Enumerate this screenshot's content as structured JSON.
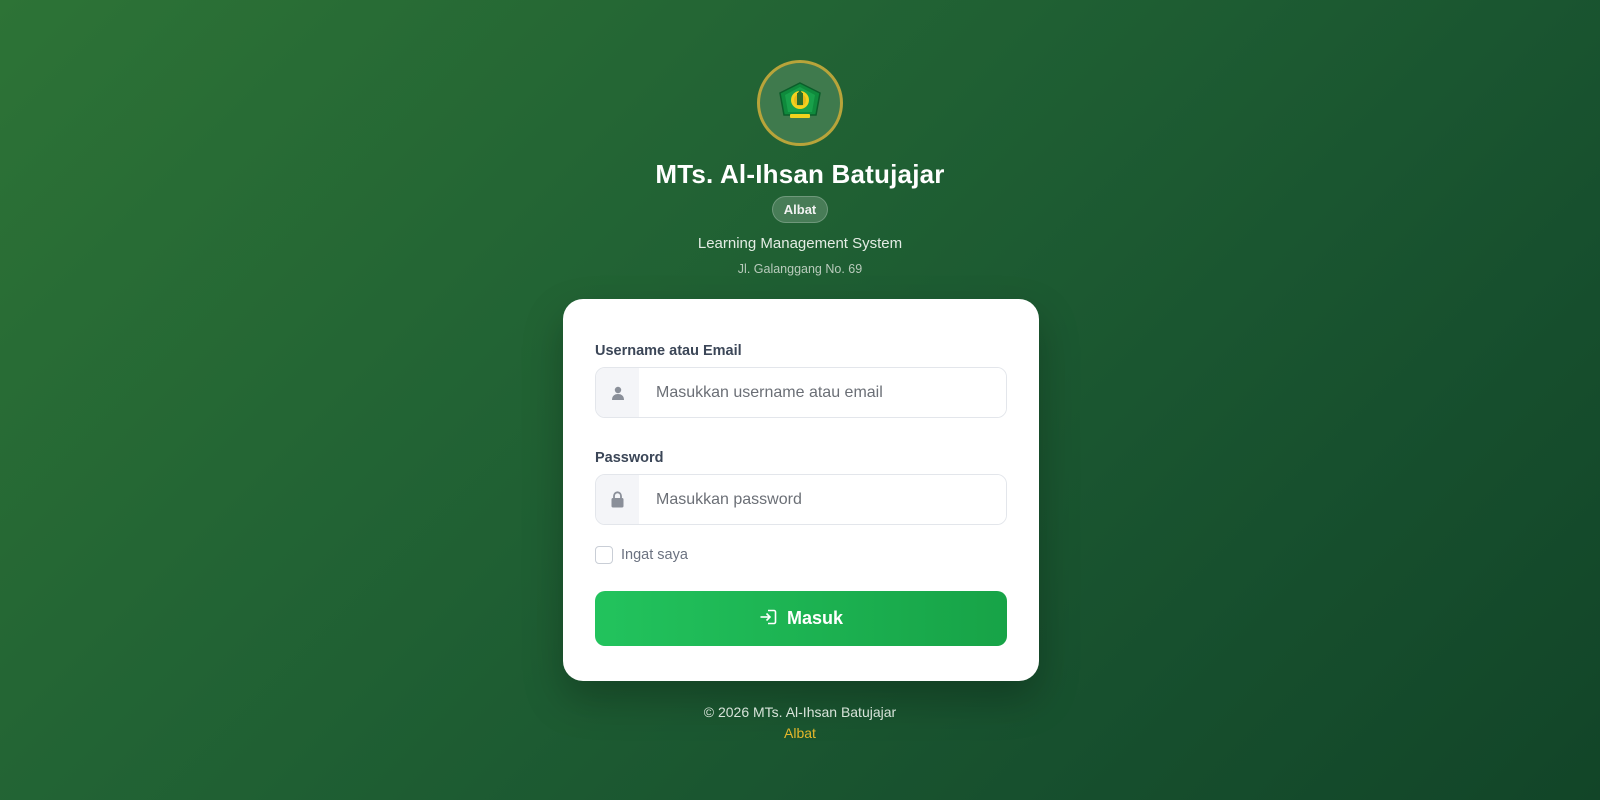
{
  "header": {
    "logo_icon": "school-crest-icon",
    "school_name": "MTs. Al-Ihsan Batujajar",
    "badge": "Albat",
    "subtitle": "Learning Management System",
    "address": "Jl. Galanggang No. 69"
  },
  "form": {
    "username_label": "Username atau Email",
    "username_placeholder": "Masukkan username atau email",
    "username_icon": "user-icon",
    "password_label": "Password",
    "password_placeholder": "Masukkan password",
    "password_icon": "lock-icon",
    "remember_label": "Ingat saya",
    "remember_checked": false,
    "submit_label": "Masuk",
    "submit_icon": "login-icon"
  },
  "footer": {
    "copyright": "© 2026 MTs. Al-Ihsan Batujajar",
    "brand": "Albat"
  },
  "colors": {
    "background": "#1f5f33",
    "accent_green": "#22c35d",
    "footer_brand": "#e5b72b",
    "logo_ring": "#b8a43a"
  }
}
